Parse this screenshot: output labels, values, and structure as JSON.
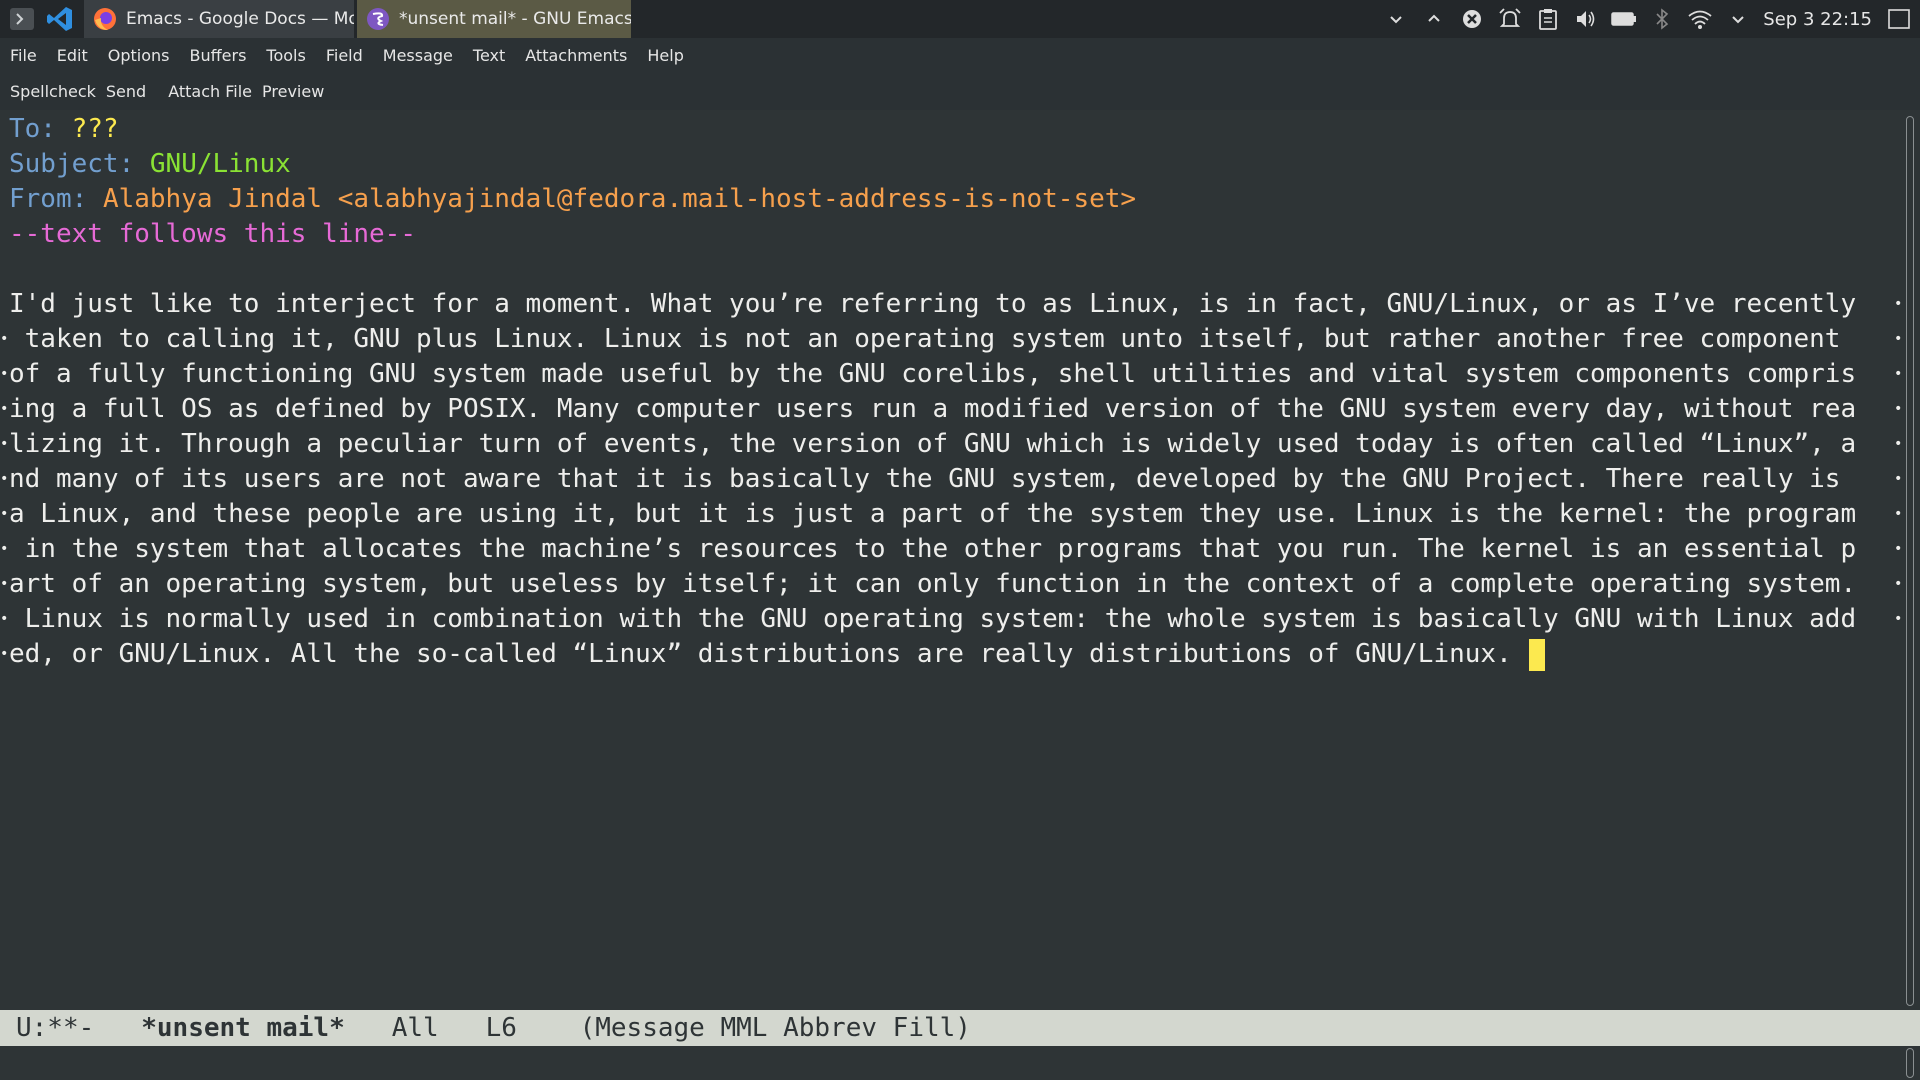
{
  "taskbar": {
    "tasks": [
      {
        "label": "Emacs - Google Docs — Mozi...",
        "icon": "firefox-icon"
      },
      {
        "label": "*unsent mail* - GNU Emacs ...",
        "icon": "emacs-icon"
      }
    ],
    "clock": "Sep 3 22:15"
  },
  "menubar": {
    "items": [
      "File",
      "Edit",
      "Options",
      "Buffers",
      "Tools",
      "Field",
      "Message",
      "Text",
      "Attachments",
      "Help"
    ]
  },
  "toolbar": {
    "items": [
      "Spellcheck",
      "Send",
      "Attach File",
      "Preview"
    ]
  },
  "headers": {
    "to_label": "To:",
    "to_value": "???",
    "subject_label": "Subject:",
    "subject_value": "GNU/Linux",
    "from_label": "From:",
    "from_value": "Alabhya Jindal <alabhyajindal@fedora.mail-host-address-is-not-set>",
    "separator": "--text follows this line--"
  },
  "body": {
    "lines": [
      "I'd just like to interject for a moment. What you’re referring to as Linux, is in fact, GNU/Linux, or as I’ve recently",
      " taken to calling it, GNU plus Linux. Linux is not an operating system unto itself, but rather another free component ",
      "of a fully functioning GNU system made useful by the GNU corelibs, shell utilities and vital system components compris",
      "ing a full OS as defined by POSIX. Many computer users run a modified version of the GNU system every day, without rea",
      "lizing it. Through a peculiar turn of events, the version of GNU which is widely used today is often called “Linux”, a",
      "nd many of its users are not aware that it is basically the GNU system, developed by the GNU Project. There really is ",
      "a Linux, and these people are using it, but it is just a part of the system they use. Linux is the kernel: the program",
      " in the system that allocates the machine’s resources to the other programs that you run. The kernel is an essential p",
      "art of an operating system, but useless by itself; it can only function in the context of a complete operating system.",
      " Linux is normally used in combination with the GNU operating system: the whole system is basically GNU with Linux add",
      "ed, or GNU/Linux. All the so-called “Linux” distributions are really distributions of GNU/Linux. "
    ]
  },
  "modeline": {
    "status": "U:**-",
    "buffer": "*unsent mail*",
    "position": "All",
    "line": "L6",
    "modes": "(Message MML Abbrev Fill)"
  },
  "colors": {
    "background": "#2e3436",
    "header_name": "#729fcf",
    "to_value": "#fce94f",
    "subject_value": "#8ae234",
    "from_value": "#f6a04d",
    "separator": "#e66ad6",
    "cursor": "#fce94f"
  }
}
